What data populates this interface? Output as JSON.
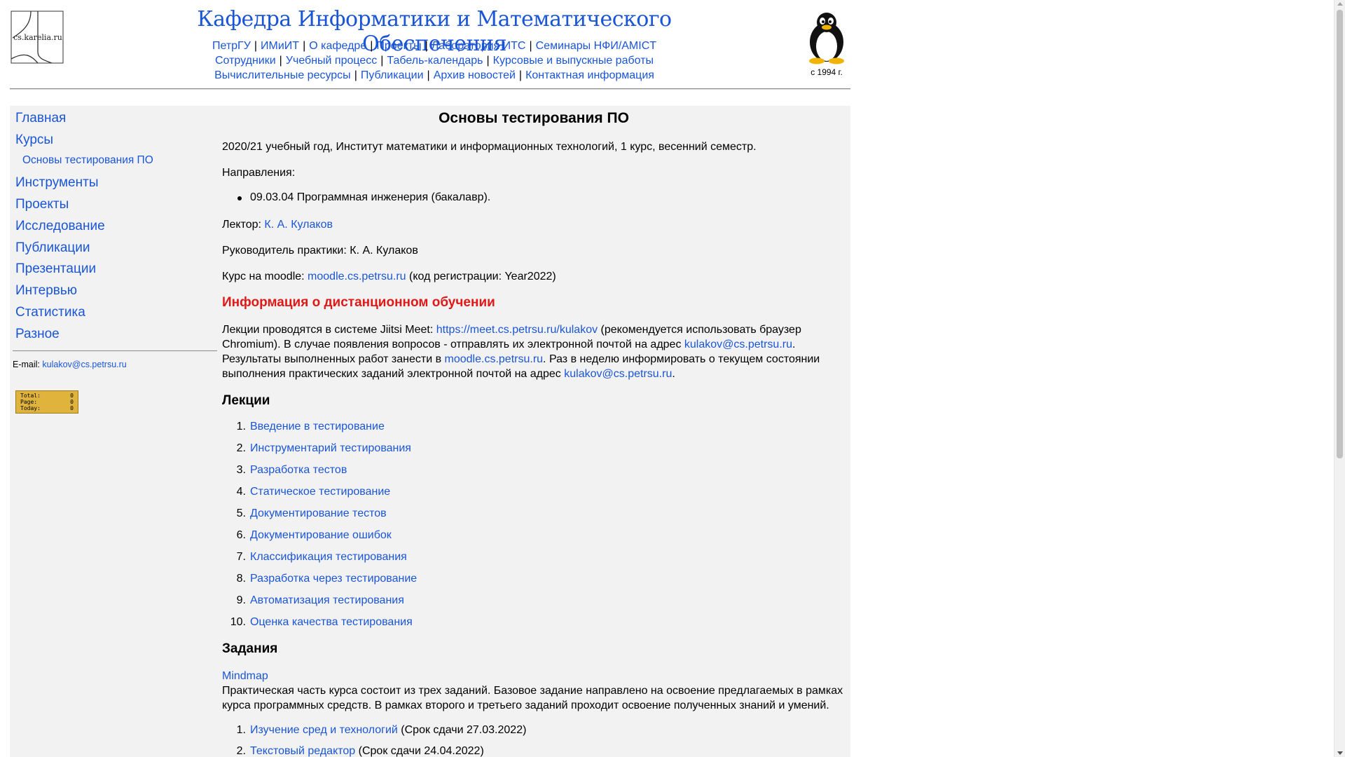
{
  "header": {
    "logo_text": "cs.karelia.ru",
    "title": "Кафедра Информатики и Математического Обеспечения",
    "since": "с 1994 г.",
    "nav_row1": [
      "ПетрГУ",
      "ИМиИТ",
      "О кафедре",
      "Проекты",
      "Лаборатория ИТС",
      "Семинары НФИ/AMICT"
    ],
    "nav_row2": [
      "Сотрудники",
      "Учебный процесс",
      "Табель-календарь",
      "Курсовые и выпускные работы"
    ],
    "nav_row3": [
      "Вычислительные ресурсы",
      "Публикации",
      "Архив новостей",
      "Контактная информация"
    ]
  },
  "sidebar": {
    "items": [
      "Главная",
      "Курсы",
      "Основы тестирования ПО",
      "Инструменты",
      "Проекты",
      "Исследование",
      "Публикации",
      "Презентации",
      "Интервью",
      "Статистика",
      "Разное"
    ],
    "email_label": "E-mail:",
    "email": "kulakov@cs.petrsu.ru",
    "counter": {
      "labels": [
        "Total:",
        "Page:",
        "Today:"
      ],
      "values": [
        "0",
        "0",
        "0"
      ]
    }
  },
  "content": {
    "title": "Основы тестирования ПО",
    "intro": "2020/21 учебный год, Институт математики и информационных технологий, 1 курс, весенний семестр.",
    "directions_label": "Направления:",
    "direction": "09.03.04 Программная инженерия (бакалавр).",
    "lecturer_label": "Лектор:",
    "lecturer": "К. А. Кулаков",
    "practice": "Руководитель практики: К. А. Кулаков",
    "moodle_prefix": "Курс на moodle:",
    "moodle_link": "moodle.cs.petrsu.ru",
    "moodle_suffix": "(код регистрации: Year2022)",
    "distance_heading": "Информация о дистанционном обучении",
    "distance_p1": "Лекции проводятся в системе Jiitsi Meet:",
    "distance_link1": "https://meet.cs.petrsu.ru/kulakov",
    "distance_p2": "(рекомендуется использовать браузер",
    "distance_p3": "Chromium). В случае появления вопросов - отправлять их электронной почтой на адрес",
    "distance_email": "kulakov@cs.petrsu.ru",
    "dot": ".",
    "distance_p4": "Результаты выполненных работ занести в",
    "distance_moodle": "moodle.cs.petrsu.ru",
    "distance_p5": ". Раз в неделю информировать о текущем состоянии",
    "distance_p6": "выполнения практических заданий электронной почтой на адрес",
    "lectures_heading": "Лекции",
    "lectures": [
      "Введение в тестирование",
      "Инструментарий тестирования",
      "Разработка тестов",
      "Статическое тестирование",
      "Документирование тестов",
      "Документирование ошибок",
      "Классификация тестирования",
      "Разработка через тестирование",
      "Автоматизация тестирования",
      "Оценка качества тестирования"
    ],
    "tasks_heading": "Задания",
    "mindmap": "Mindmap",
    "tasks_p1": "Практическая часть курса состоит из трех заданий. Базовое задание направлено на освоение предлагаемых в рамках",
    "tasks_p2": "курса программных средств. В рамках второго и третьего заданий проходит освоение полученных знаний и умений.",
    "tasks": [
      {
        "title": "Изучение сред и технологий",
        "deadline": "(Срок сдачи 27.03.2022)"
      },
      {
        "title": "Текстовый редактор",
        "deadline": "(Срок сдачи 24.04.2022)"
      }
    ]
  },
  "colors": {
    "link": "#1a55d6",
    "heading_red": "#e01818",
    "box_bg": "#f2f2f2",
    "counter": "#e0b33d"
  },
  "icons": [
    "site-logo",
    "tux-penguin-logo"
  ]
}
